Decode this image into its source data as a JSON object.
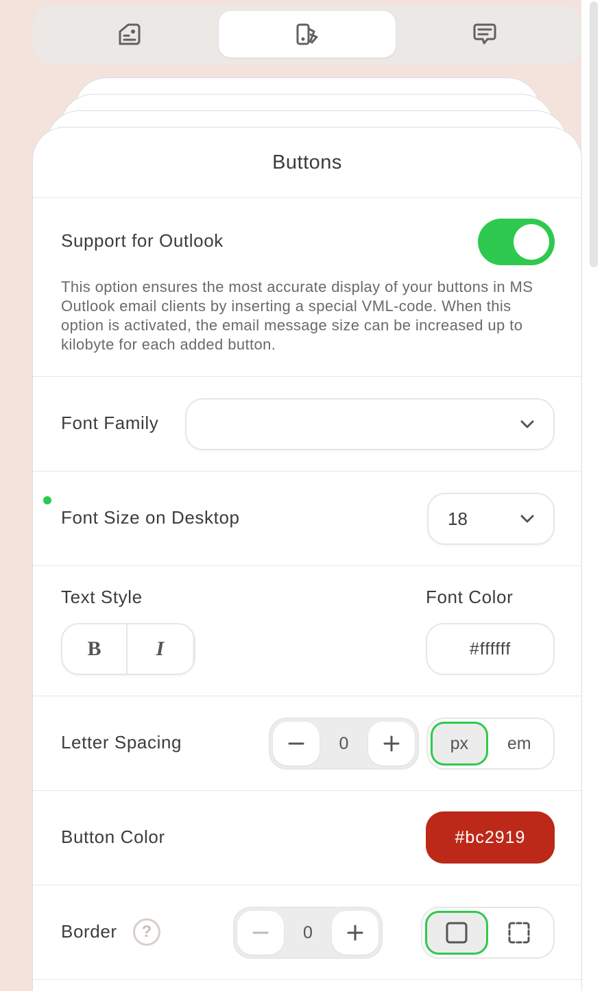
{
  "tabs": [
    {
      "icon": "content-blocks-icon"
    },
    {
      "icon": "appearance-icon",
      "active": true
    },
    {
      "icon": "chat-icon"
    }
  ],
  "panel": {
    "title": "Buttons",
    "outlook": {
      "label": "Support for Outlook",
      "enabled": true,
      "description": "This option ensures the most accurate display of your buttons in MS Outlook email clients by inserting a special VML-code. When this option is activated, the email message size can be increased up to kilobyte for each added button."
    },
    "font_family": {
      "label": "Font Family",
      "value": ""
    },
    "font_size": {
      "label": "Font Size on Desktop",
      "value": "18"
    },
    "text_style": {
      "label": "Text Style",
      "bold": "B",
      "italic": "I"
    },
    "font_color": {
      "label": "Font Color",
      "value": "#ffffff"
    },
    "letter_spacing": {
      "label": "Letter Spacing",
      "value": "0",
      "units": [
        "px",
        "em"
      ],
      "selected_unit": "px"
    },
    "button_color": {
      "label": "Button Color",
      "value": "#bc2919"
    },
    "border": {
      "label": "Border",
      "help": "?",
      "value": "0"
    }
  },
  "colors": {
    "accent_green": "#2ec94e",
    "button_red": "#bc2919"
  }
}
